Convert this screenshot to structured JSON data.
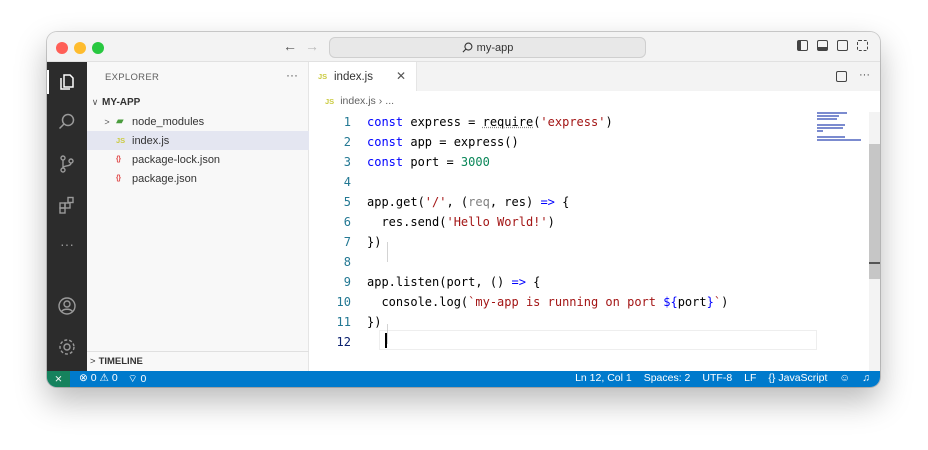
{
  "command_center": {
    "text": "my-app"
  },
  "sidebar": {
    "title": "EXPLORER",
    "root_folder": "MY-APP",
    "items": [
      {
        "label": "node_modules",
        "type": "folder"
      },
      {
        "label": "index.js",
        "type": "js",
        "badge": "JS"
      },
      {
        "label": "package-lock.json",
        "type": "json",
        "badge": "{}"
      },
      {
        "label": "package.json",
        "type": "json",
        "badge": "{}"
      }
    ],
    "timeline": "TIMELINE"
  },
  "editor": {
    "tab": {
      "label": "index.js",
      "badge": "JS"
    },
    "breadcrumb": {
      "badge": "JS",
      "file": "index.js",
      "rest": "..."
    },
    "line_numbers": [
      "1",
      "2",
      "3",
      "4",
      "5",
      "6",
      "7",
      "8",
      "9",
      "10",
      "11",
      "12"
    ],
    "current_line": 12
  },
  "statusbar": {
    "problems": "0",
    "warnings": "0",
    "ports": "0",
    "position": "Ln 12, Col 1",
    "spaces": "Spaces: 2",
    "encoding": "UTF-8",
    "eol": "LF",
    "language": "JavaScript"
  },
  "colors": {
    "statusbar": "#007acc",
    "remote": "#16825d",
    "activity_bar": "#2c2c2c",
    "keyword": "#0000ff",
    "string": "#a31515",
    "number": "#098658"
  }
}
